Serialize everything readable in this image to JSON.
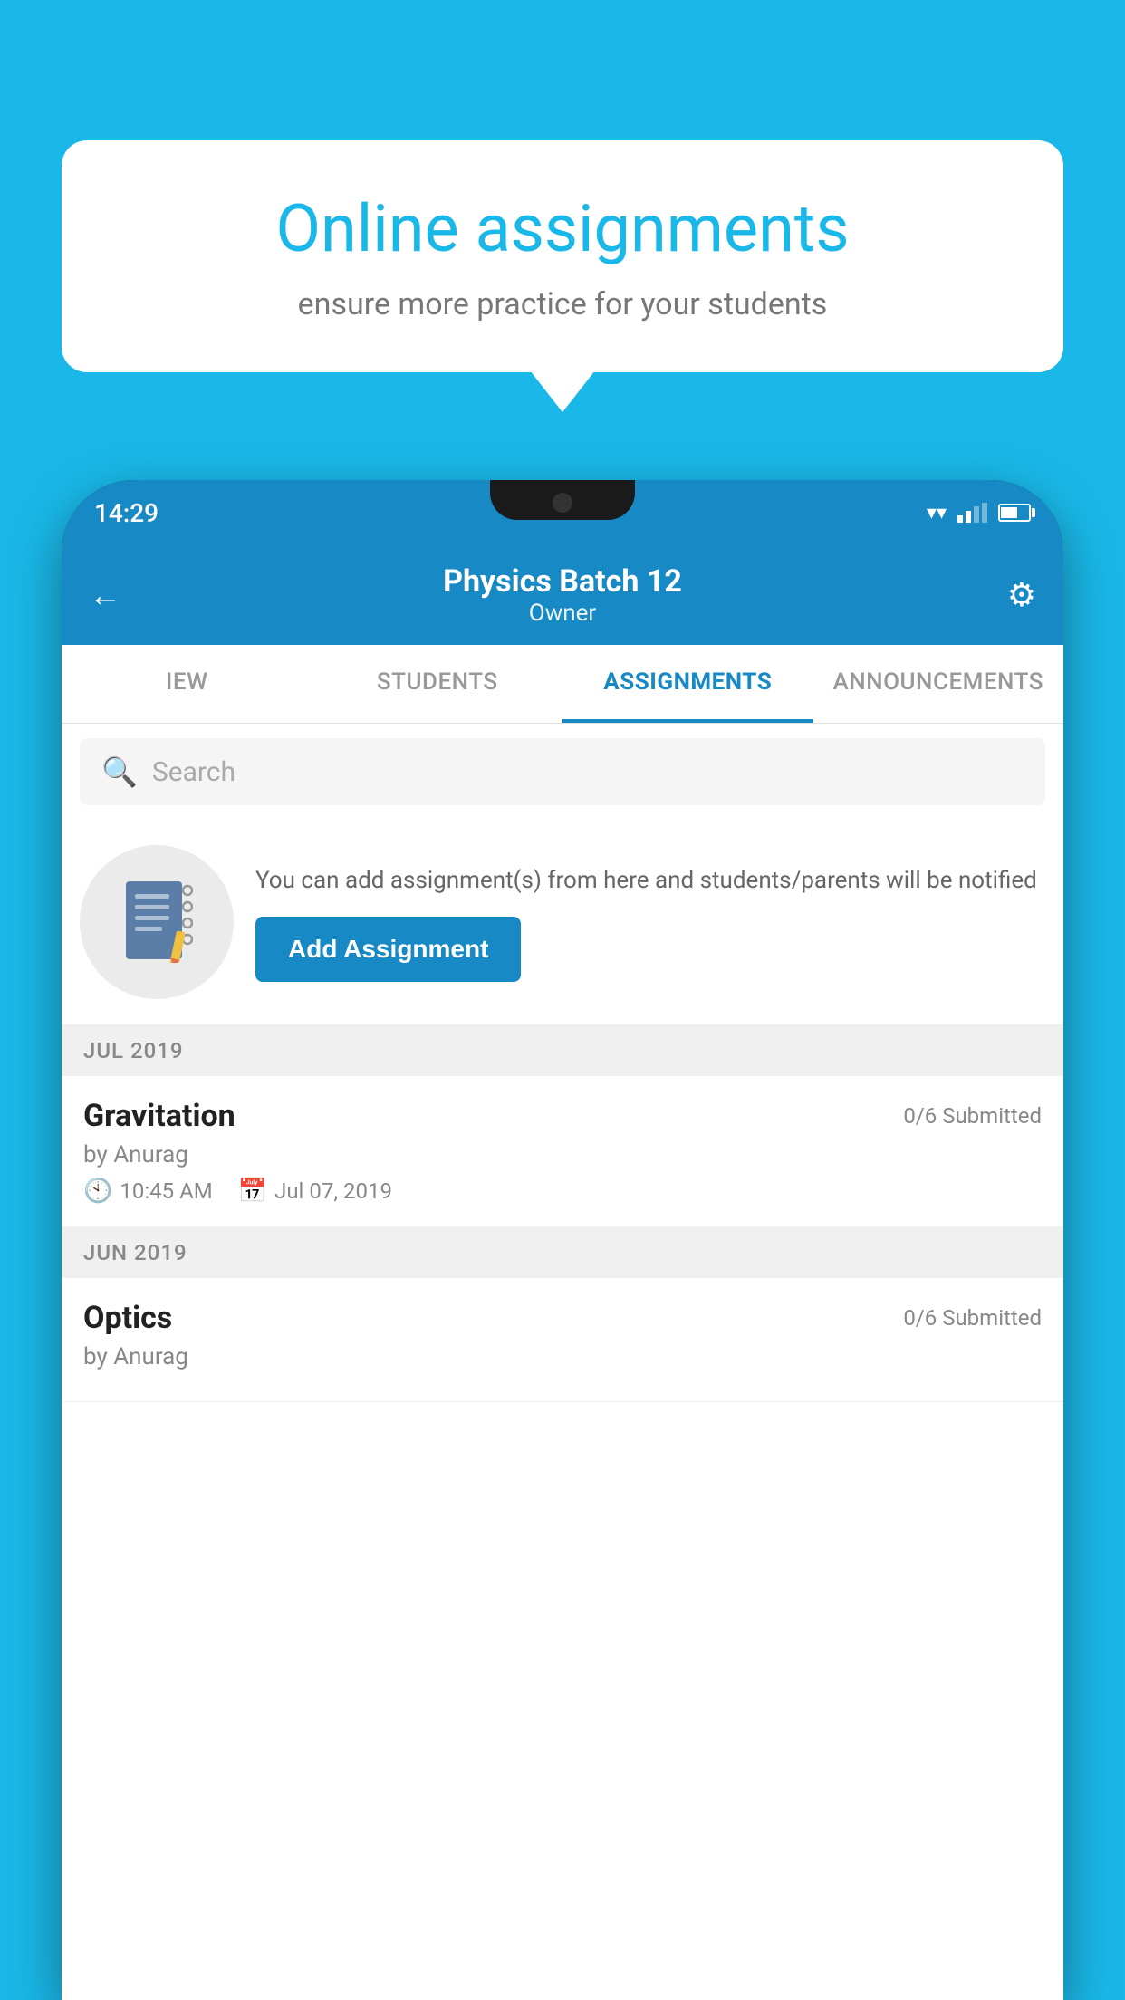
{
  "background": {
    "color": "#1ab8e8"
  },
  "promo": {
    "title": "Online assignments",
    "subtitle": "ensure more practice for your students"
  },
  "phone": {
    "status_bar": {
      "time": "14:29"
    },
    "header": {
      "title": "Physics Batch 12",
      "subtitle": "Owner",
      "back_label": "←",
      "settings_label": "⚙"
    },
    "tabs": [
      {
        "label": "IEW",
        "active": false
      },
      {
        "label": "STUDENTS",
        "active": false
      },
      {
        "label": "ASSIGNMENTS",
        "active": true
      },
      {
        "label": "ANNOUNCEMENTS",
        "active": false
      }
    ],
    "search": {
      "placeholder": "Search"
    },
    "add_assignment_section": {
      "description": "You can add assignment(s) from here and students/parents will be notified",
      "button_label": "Add Assignment"
    },
    "month_groups": [
      {
        "month": "JUL 2019",
        "assignments": [
          {
            "name": "Gravitation",
            "submitted": "0/6 Submitted",
            "by": "by Anurag",
            "time": "10:45 AM",
            "date": "Jul 07, 2019"
          }
        ]
      },
      {
        "month": "JUN 2019",
        "assignments": [
          {
            "name": "Optics",
            "submitted": "0/6 Submitted",
            "by": "by Anurag",
            "time": "",
            "date": ""
          }
        ]
      }
    ]
  }
}
